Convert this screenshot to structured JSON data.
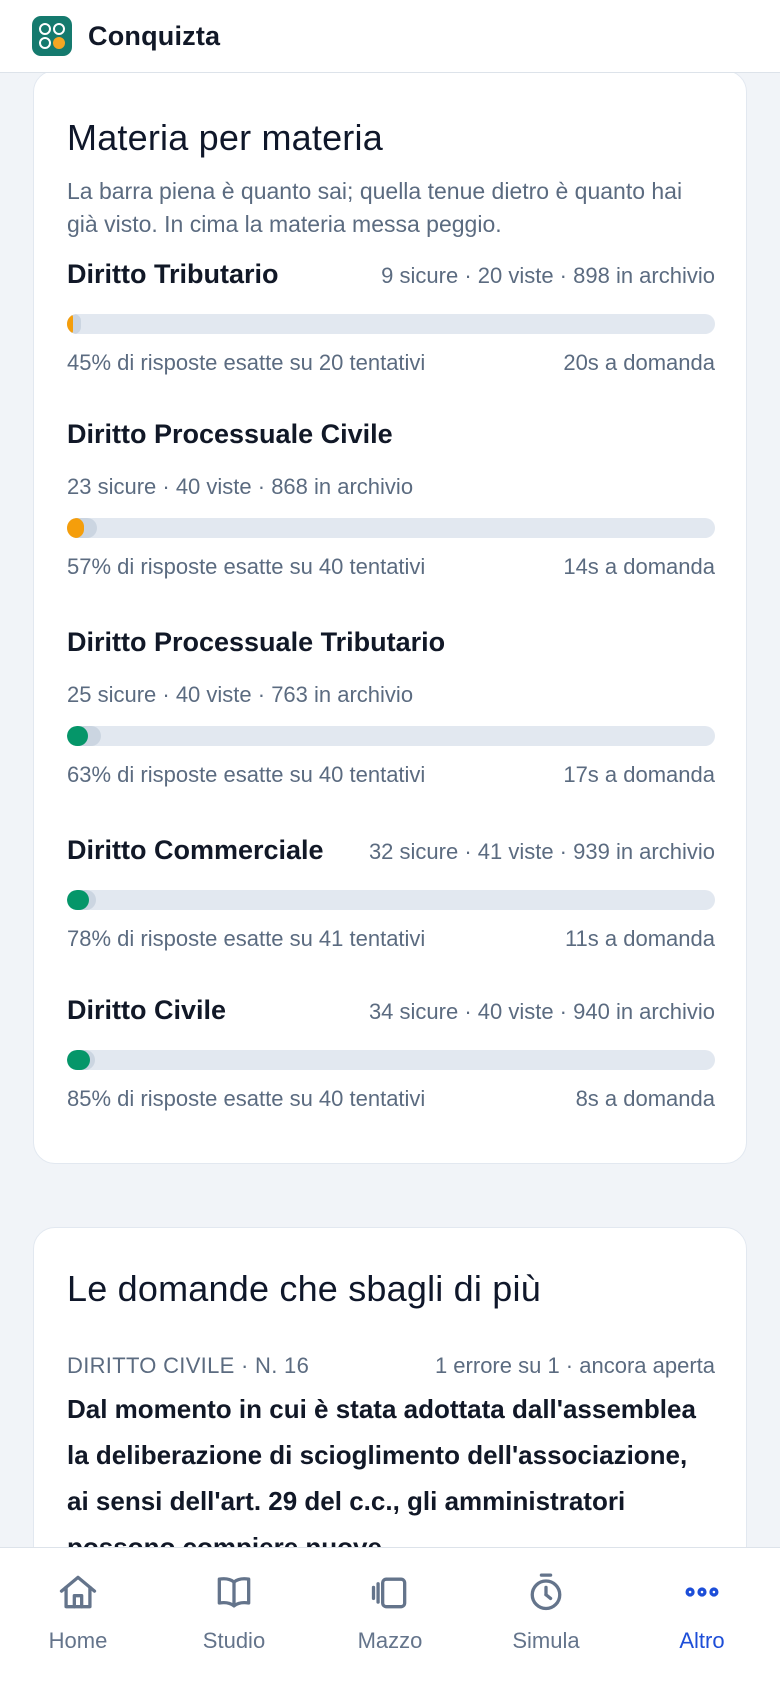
{
  "app": {
    "title": "Conquizta"
  },
  "colors": {
    "bar_orange": "#f59e0b",
    "bar_green": "#059669",
    "active_nav": "#1d4ed8"
  },
  "subjects_card": {
    "title": "Materia per materia",
    "subtitle": "La barra piena è quanto sai; quella tenue dietro è quanto hai già visto. In cima la materia messa peggio.",
    "subjects": [
      {
        "name": "Diritto Tributario",
        "stats": "9 sicure · 20 viste · 898 in archivio",
        "known_fraction": 0.01,
        "seen_fraction": 0.022,
        "color": "#f59e0b",
        "accuracy": "45% di risposte esatte su 20 tentativi",
        "time": "20s a domanda"
      },
      {
        "name": "Diritto Processuale Civile",
        "stats": "23 sicure · 40 viste · 868 in archivio",
        "known_fraction": 0.026,
        "seen_fraction": 0.046,
        "color": "#f59e0b",
        "accuracy": "57% di risposte esatte su 40 tentativi",
        "time": "14s a domanda"
      },
      {
        "name": "Diritto Processuale Tributario",
        "stats": "25 sicure · 40 viste · 763 in archivio",
        "known_fraction": 0.033,
        "seen_fraction": 0.052,
        "color": "#059669",
        "accuracy": "63% di risposte esatte su 40 tentativi",
        "time": "17s a domanda"
      },
      {
        "name": "Diritto Commerciale",
        "stats": "32 sicure · 41 viste · 939 in archivio",
        "known_fraction": 0.034,
        "seen_fraction": 0.044,
        "color": "#059669",
        "accuracy": "78% di risposte esatte su 41 tentativi",
        "time": "11s a domanda"
      },
      {
        "name": "Diritto Civile",
        "stats": "34 sicure · 40 viste · 940 in archivio",
        "known_fraction": 0.036,
        "seen_fraction": 0.043,
        "color": "#059669",
        "accuracy": "85% di risposte esatte su 40 tentativi",
        "time": "8s a domanda"
      }
    ]
  },
  "wrong_card": {
    "title": "Le domande che sbagli di più",
    "question": {
      "subject": "DIRITTO CIVILE · N. 16",
      "status": "1 errore su 1 · ancora aperta",
      "text": "Dal momento in cui è stata adottata dall'assemblea la deliberazione di scioglimento dell'associazione, ai sensi dell'art. 29 del c.c., gli amministratori possono compiere nuove"
    }
  },
  "nav": {
    "items": [
      {
        "label": "Home",
        "icon": "home-icon"
      },
      {
        "label": "Studio",
        "icon": "book-icon"
      },
      {
        "label": "Mazzo",
        "icon": "cards-icon"
      },
      {
        "label": "Simula",
        "icon": "stopwatch-icon"
      },
      {
        "label": "Altro",
        "icon": "more-icon"
      }
    ],
    "active": "Altro"
  }
}
